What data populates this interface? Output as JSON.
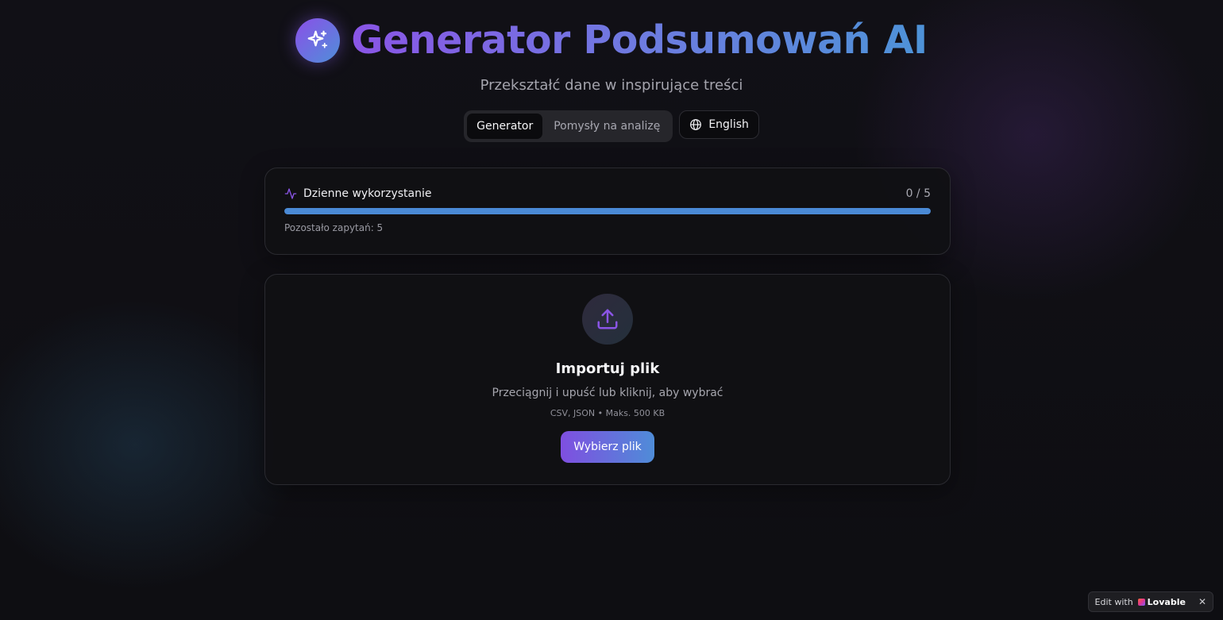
{
  "header": {
    "title": "Generator Podsumowań AI",
    "subtitle": "Przekształć dane w inspirujące treści",
    "logo_icon": "sparkles-icon"
  },
  "nav": {
    "tabs": [
      {
        "label": "Generator",
        "active": true
      },
      {
        "label": "Pomysły na analizę",
        "active": false
      }
    ],
    "language_button": {
      "label": "English",
      "icon": "globe-icon"
    }
  },
  "usage": {
    "label": "Dzienne wykorzystanie",
    "icon": "activity-icon",
    "count": "0 / 5",
    "used": 0,
    "limit": 5,
    "remaining_text": "Pozostało zapytań: 5"
  },
  "upload": {
    "icon": "upload-icon",
    "title": "Importuj plik",
    "description": "Przeciągnij i upuść lub kliknij, aby wybrać",
    "formats": "CSV, JSON • Maks. 500 KB",
    "button_label": "Wybierz plik"
  },
  "badge": {
    "prefix": "Edit with",
    "brand": "Lovable",
    "close_symbol": "✕"
  },
  "colors": {
    "accent_purple": "#8a55e6",
    "accent_blue": "#4d93d8",
    "progress_fill": "#4a8ad6"
  }
}
